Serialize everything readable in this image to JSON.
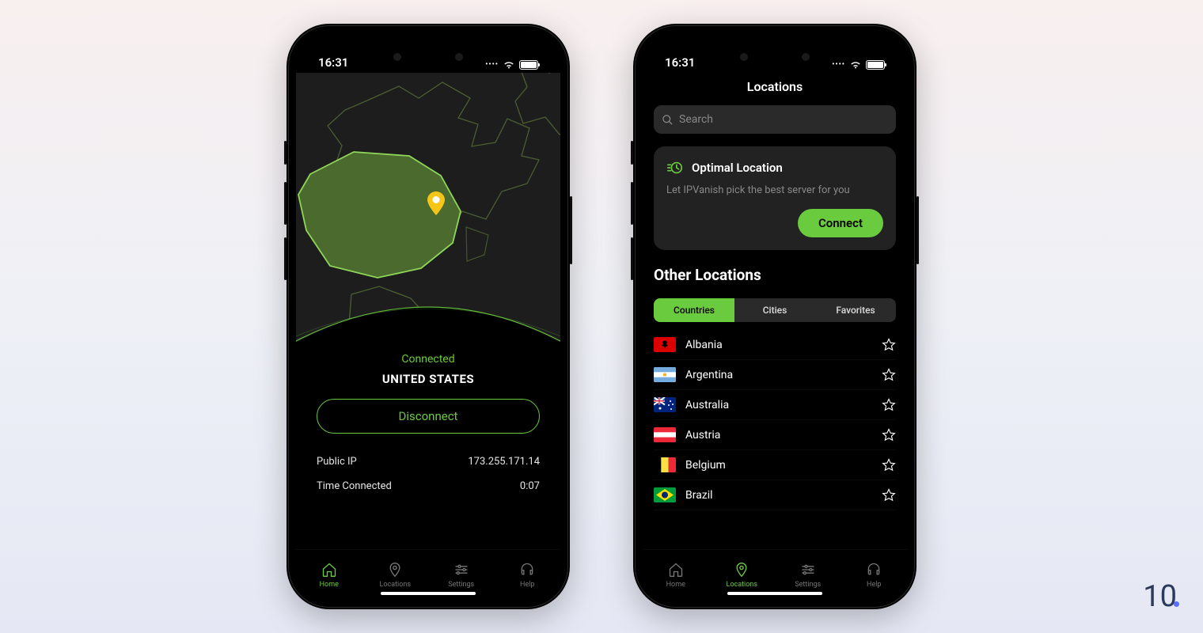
{
  "statusbar": {
    "time": "16:31"
  },
  "home": {
    "status": "Connected",
    "country": "UNITED STATES",
    "disconnect_label": "Disconnect",
    "rows": [
      {
        "label": "Public IP",
        "value": "173.255.171.14"
      },
      {
        "label": "Time Connected",
        "value": "0:07"
      }
    ]
  },
  "tabs": [
    {
      "label": "Home"
    },
    {
      "label": "Locations"
    },
    {
      "label": "Settings"
    },
    {
      "label": "Help"
    }
  ],
  "locations": {
    "title": "Locations",
    "search_placeholder": "Search",
    "optimal": {
      "title": "Optimal Location",
      "subtitle": "Let IPVanish pick the best server for you",
      "connect_label": "Connect"
    },
    "other_heading": "Other Locations",
    "segments": [
      "Countries",
      "Cities",
      "Favorites"
    ],
    "countries": [
      {
        "name": "Albania"
      },
      {
        "name": "Argentina"
      },
      {
        "name": "Australia"
      },
      {
        "name": "Austria"
      },
      {
        "name": "Belgium"
      },
      {
        "name": "Brazil"
      }
    ]
  },
  "watermark": "10"
}
